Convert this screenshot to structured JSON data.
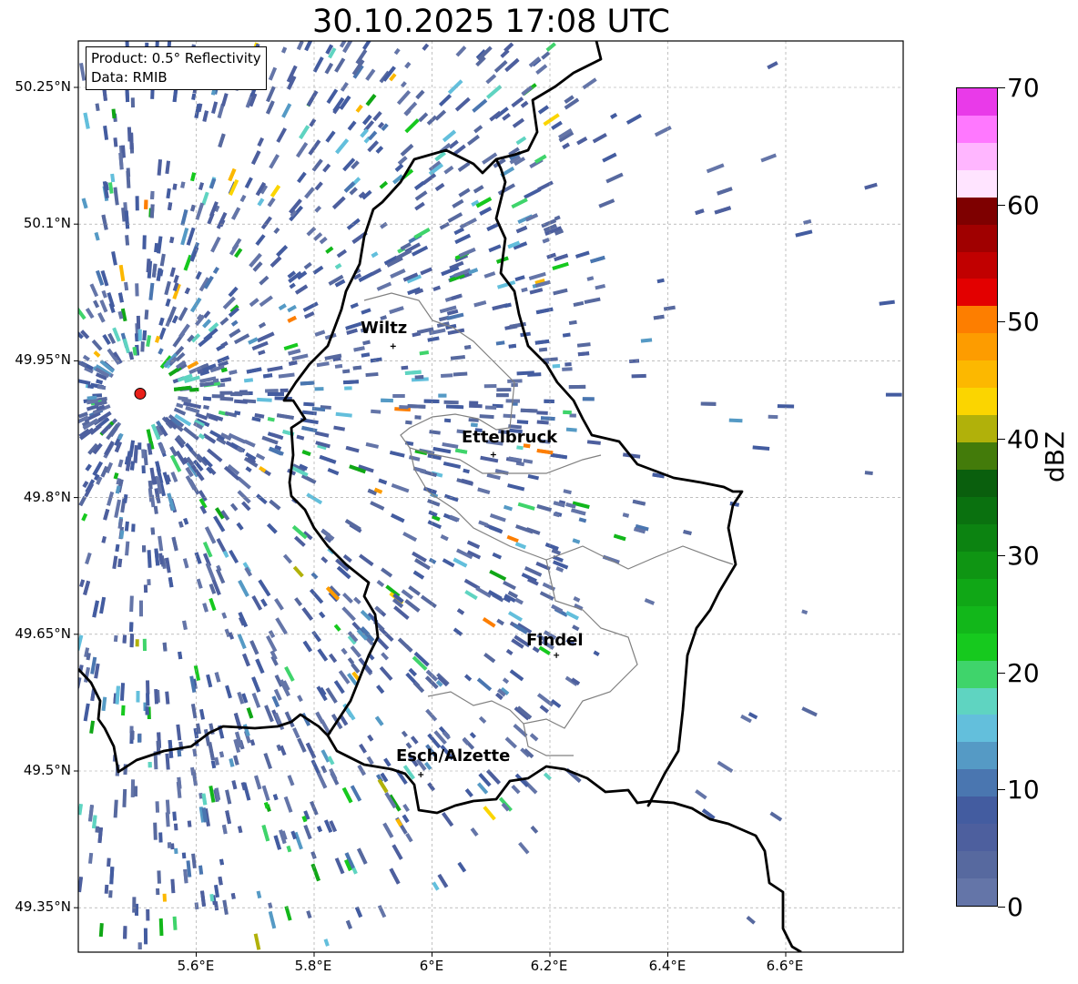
{
  "title": "30.10.2025 17:08 UTC",
  "info": {
    "product": "Product: 0.5° Reflectivity",
    "data": "Data: RMIB"
  },
  "lat_ticks": [
    "50.25°N",
    "50.1°N",
    "49.95°N",
    "49.8°N",
    "49.65°N",
    "49.5°N",
    "49.35°N"
  ],
  "lon_ticks": [
    "5.6°E",
    "5.8°E",
    "6°E",
    "6.2°E",
    "6.4°E",
    "6.6°E"
  ],
  "cities": [
    {
      "name": "Wiltz",
      "lon": 5.934,
      "lat": 49.966
    },
    {
      "name": "Ettelbruck",
      "lon": 6.104,
      "lat": 49.847
    },
    {
      "name": "Findel",
      "lon": 6.211,
      "lat": 49.627
    },
    {
      "name": "Esch/Alzette",
      "lon": 5.981,
      "lat": 49.496
    }
  ],
  "radar_site": {
    "lon": 5.505,
    "lat": 49.914,
    "color": "#e8201a"
  },
  "map_extent": {
    "lon_min": 5.4,
    "lon_max": 6.8,
    "lat_min": 49.3,
    "lat_max": 50.3
  },
  "colorbar": {
    "unit": "dBZ",
    "min": 0,
    "max": 70,
    "tick_labels": [
      "0",
      "10",
      "20",
      "30",
      "40",
      "50",
      "60",
      "70"
    ],
    "colors": [
      "#6475a8",
      "#57699f",
      "#4d5f9e",
      "#435ca0",
      "#4a76b0",
      "#559ac5",
      "#63bfdc",
      "#5fd4c1",
      "#3fd46b",
      "#16c91e",
      "#12b71a",
      "#10a716",
      "#0f9513",
      "#0c8311",
      "#0a710f",
      "#0a5f0d",
      "#437b0a",
      "#b1b10a",
      "#fbd500",
      "#fcb800",
      "#fd9c00",
      "#fd7e00",
      "#e30000",
      "#c10000",
      "#a00000",
      "#7e0000",
      "#ffe4ff",
      "#ffb6ff",
      "#ff78ff",
      "#e93ae9"
    ]
  }
}
